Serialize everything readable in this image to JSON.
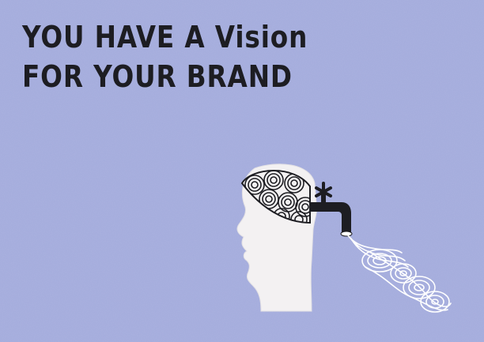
{
  "headline": {
    "line1": "YOU HAVE A Vision",
    "line2": "FOR YOUR BRAND"
  },
  "colors": {
    "background": "#a3abdc",
    "ink": "#1d1d22",
    "head": "#f3f1f2",
    "swirl": "#ffffff"
  },
  "icons": {
    "head": "head-silhouette",
    "brain": "swirl-brain",
    "tap": "water-tap",
    "stream": "swirl-stream"
  }
}
